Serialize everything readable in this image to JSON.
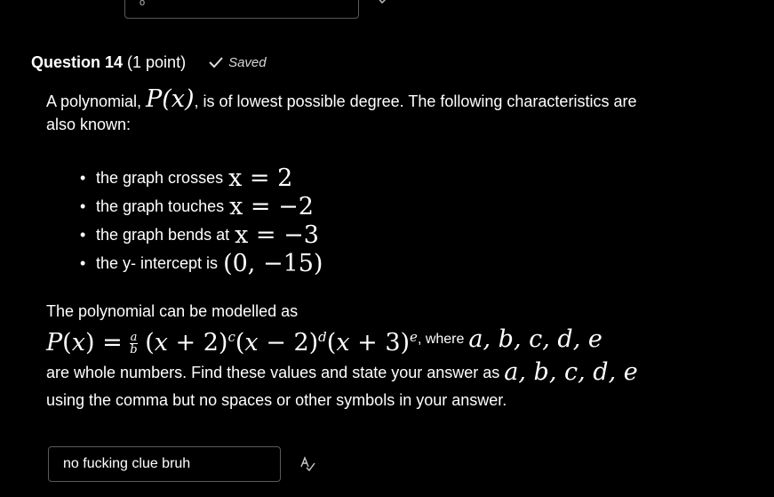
{
  "question": {
    "title": "Question 14",
    "points": "(1 point)",
    "saved_label": "Saved"
  },
  "previous_field": {
    "mark": "o"
  },
  "intro": {
    "part1": "A polynomial,",
    "math_P": "P(x)",
    "part2": ", is of lowest possible degree.  The following characteristics are",
    "line2": "also known:"
  },
  "characteristics": [
    {
      "text": "the graph crosses",
      "math": "x = 2"
    },
    {
      "text": "the graph touches",
      "math": "x = −2"
    },
    {
      "text": "the graph bends at",
      "math": "x = −3"
    },
    {
      "text": "the y- intercept is",
      "math": "(0, −15)"
    }
  ],
  "model": {
    "line1": "The polynomial can be modelled as",
    "where": ", where",
    "vars": "a, b, c, d, e",
    "line3a": "are whole numbers.  Find these values and state your answer as",
    "line4": "using the comma but no spaces or other symbols in your answer."
  },
  "answer": {
    "value": "no fucking clue bruh"
  },
  "icons": {
    "saved": "checkmark-icon",
    "spellcheck": "spellcheck-icon"
  }
}
